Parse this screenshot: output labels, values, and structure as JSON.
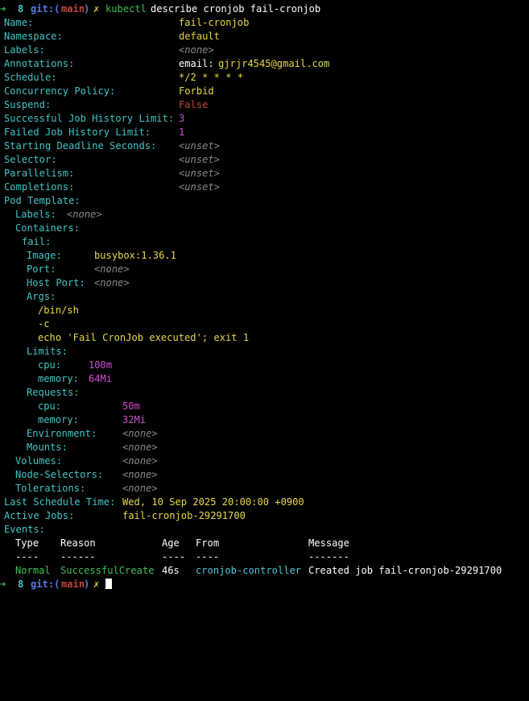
{
  "prompt": {
    "arrow": "➜",
    "count": "8",
    "git_prefix": "git:(",
    "branch": "main",
    "git_suffix": ")",
    "dirty": "✗",
    "command_name": "kubectl",
    "command_args": "describe cronjob fail-cronjob"
  },
  "fields": {
    "name": {
      "label": "Name:",
      "value": "fail-cronjob"
    },
    "namespace": {
      "label": "Namespace:",
      "value": "default"
    },
    "labels": {
      "label": "Labels:",
      "value": "<none>"
    },
    "annotations": {
      "label": "Annotations:",
      "key": "email:",
      "value": "gjrjr4545@gmail.com"
    },
    "schedule": {
      "label": "Schedule:",
      "value": "*/2 * * * *"
    },
    "concurrency": {
      "label": "Concurrency Policy:",
      "value": "Forbid"
    },
    "suspend": {
      "label": "Suspend:",
      "value": "False"
    },
    "success_limit": {
      "label": "Successful Job History Limit:",
      "value": "3"
    },
    "failed_limit": {
      "label": "Failed Job History Limit:",
      "value": "1"
    },
    "deadline": {
      "label": "Starting Deadline Seconds:",
      "value": "<unset>"
    },
    "selector": {
      "label": "Selector:",
      "value": "<unset>"
    },
    "parallelism": {
      "label": "Parallelism:",
      "value": "<unset>"
    },
    "completions": {
      "label": "Completions:",
      "value": "<unset>"
    }
  },
  "pod_template": {
    "label": "Pod Template:",
    "labels_label": "Labels:",
    "labels_value": "<none>",
    "containers_label": "Containers:",
    "container_name": "fail:",
    "image_label": "Image:",
    "image_value": "busybox:1.36.1",
    "port_label": "Port:",
    "port_value": "<none>",
    "host_port_label": "Host Port:",
    "host_port_value": "<none>",
    "args_label": "Args:",
    "args": [
      "/bin/sh",
      "-c",
      "echo 'Fail CronJob executed'; exit 1"
    ],
    "limits_label": "Limits:",
    "limits_cpu_label": "cpu:",
    "limits_cpu_value": "100m",
    "limits_mem_label": "memory:",
    "limits_mem_value": "64Mi",
    "requests_label": "Requests:",
    "requests_cpu_label": "cpu:",
    "requests_cpu_value": "50m",
    "requests_mem_label": "memory:",
    "requests_mem_value": "32Mi",
    "environment_label": "Environment:",
    "environment_value": "<none>",
    "mounts_label": "Mounts:",
    "mounts_value": "<none>",
    "volumes_label": "Volumes:",
    "volumes_value": "<none>",
    "node_selectors_label": "Node-Selectors:",
    "node_selectors_value": "<none>",
    "tolerations_label": "Tolerations:",
    "tolerations_value": "<none>"
  },
  "last_schedule": {
    "label": "Last Schedule Time:",
    "value": "Wed, 10 Sep 2025 20:00:00 +0900"
  },
  "active_jobs": {
    "label": "Active Jobs:",
    "value": "fail-cronjob-29291700"
  },
  "events": {
    "label": "Events:",
    "headers": {
      "type": "Type",
      "reason": "Reason",
      "age": "Age",
      "from": "From",
      "message": "Message"
    },
    "dashes": {
      "type": "----",
      "reason": "------",
      "age": "----",
      "from": "----",
      "message": "-------"
    },
    "row": {
      "type": "Normal",
      "reason": "SuccessfulCreate",
      "age": "46s",
      "from": "cronjob-controller",
      "message": "Created job fail-cronjob-29291700"
    }
  },
  "next_prompt": {
    "arrow": "➜",
    "count": "8",
    "git_prefix": "git:(",
    "branch": "main",
    "git_suffix": ")",
    "dirty": "✗"
  }
}
